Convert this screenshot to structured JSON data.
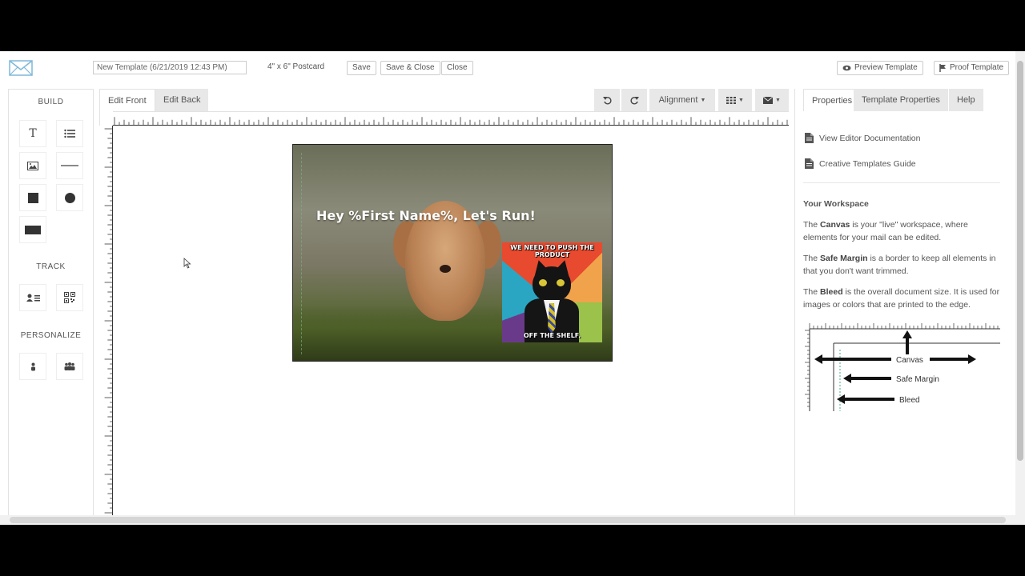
{
  "topbar": {
    "template_name": "New Template (6/21/2019 12:43 PM)",
    "size_label": "4\" x 6\" Postcard",
    "save_label": "Save",
    "save_close_label": "Save & Close",
    "close_label": "Close",
    "preview_label": "Preview Template",
    "proof_label": "Proof Template"
  },
  "build": {
    "title": "BUILD",
    "tools": [
      "text-icon",
      "list-icon",
      "image-icon",
      "line-icon",
      "square-icon",
      "circle-icon",
      "rectangle-icon"
    ]
  },
  "track": {
    "title": "TRACK",
    "tools": [
      "contact-card-icon",
      "qr-code-icon"
    ]
  },
  "personalize": {
    "title": "PERSONALIZE",
    "tools": [
      "person-icon",
      "group-icon"
    ]
  },
  "editor": {
    "tab_front": "Edit Front",
    "tab_back": "Edit Back",
    "alignment_label": "Alignment",
    "undo_icon": "undo-icon",
    "redo_icon": "redo-icon",
    "grid_icon": "grid-icon",
    "mail_icon": "envelope-icon"
  },
  "postcard": {
    "headline": "Hey %First Name%, Let's Run!",
    "meme_top": "WE NEED TO PUSH THE PRODUCT",
    "meme_bottom": "OFF THE SHELF."
  },
  "right_panel": {
    "tab_properties": "Properties",
    "tab_template_properties": "Template Properties",
    "tab_help": "Help",
    "link_docs": "View Editor Documentation",
    "link_guide": "Creative Templates Guide",
    "workspace_heading": "Your Workspace",
    "canvas_term": "Canvas",
    "canvas_text": " is your \"live\" workspace, where elements for your mail can be edited.",
    "safe_term": "Safe Margin",
    "safe_text": " is a border to keep all elements in that you don't want trimmed.",
    "bleed_term": "Bleed",
    "bleed_text": " is the overall document size. It is used for images or colors that are printed to the edge.",
    "the_word": "The ",
    "diagram": {
      "canvas_label": "Canvas",
      "safe_label": "Safe Margin",
      "bleed_label": "Bleed"
    }
  }
}
